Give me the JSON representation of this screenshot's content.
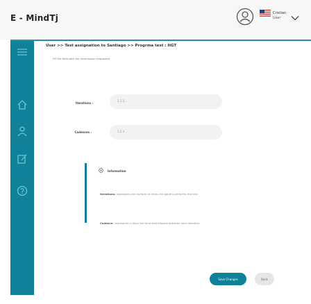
{
  "app": {
    "title": "E - MindTj"
  },
  "user": {
    "name": "Cristian",
    "role": "User"
  },
  "breadcrumb": "User >> Test assignation to Santiago >> Progrma test : HGT",
  "hint": "Fill the field with the information requested",
  "form": {
    "iterations": {
      "label": "Iterations :",
      "value": "1.2.3..."
    },
    "cadences": {
      "label": "Cadences :",
      "value": "1.2.3..."
    }
  },
  "info": {
    "title": "Information",
    "iterations_term": "Iterations:",
    "iterations_text": "represents the number of times the patient performs the test.",
    "cadence_term": "Cadence:",
    "cadence_text": "represents in days the time that elapses between each iteration."
  },
  "buttons": {
    "save": "Save Changes",
    "back": "Back"
  },
  "colors": {
    "accent": "#0f8199",
    "topbar": "#f7f7f7",
    "field": "#f2f2f2"
  },
  "icons": [
    "user-icon",
    "flag-icon",
    "chevron-down-icon",
    "menu-icon",
    "home-icon",
    "profile-icon",
    "edit-icon",
    "help-icon",
    "info-icon"
  ]
}
